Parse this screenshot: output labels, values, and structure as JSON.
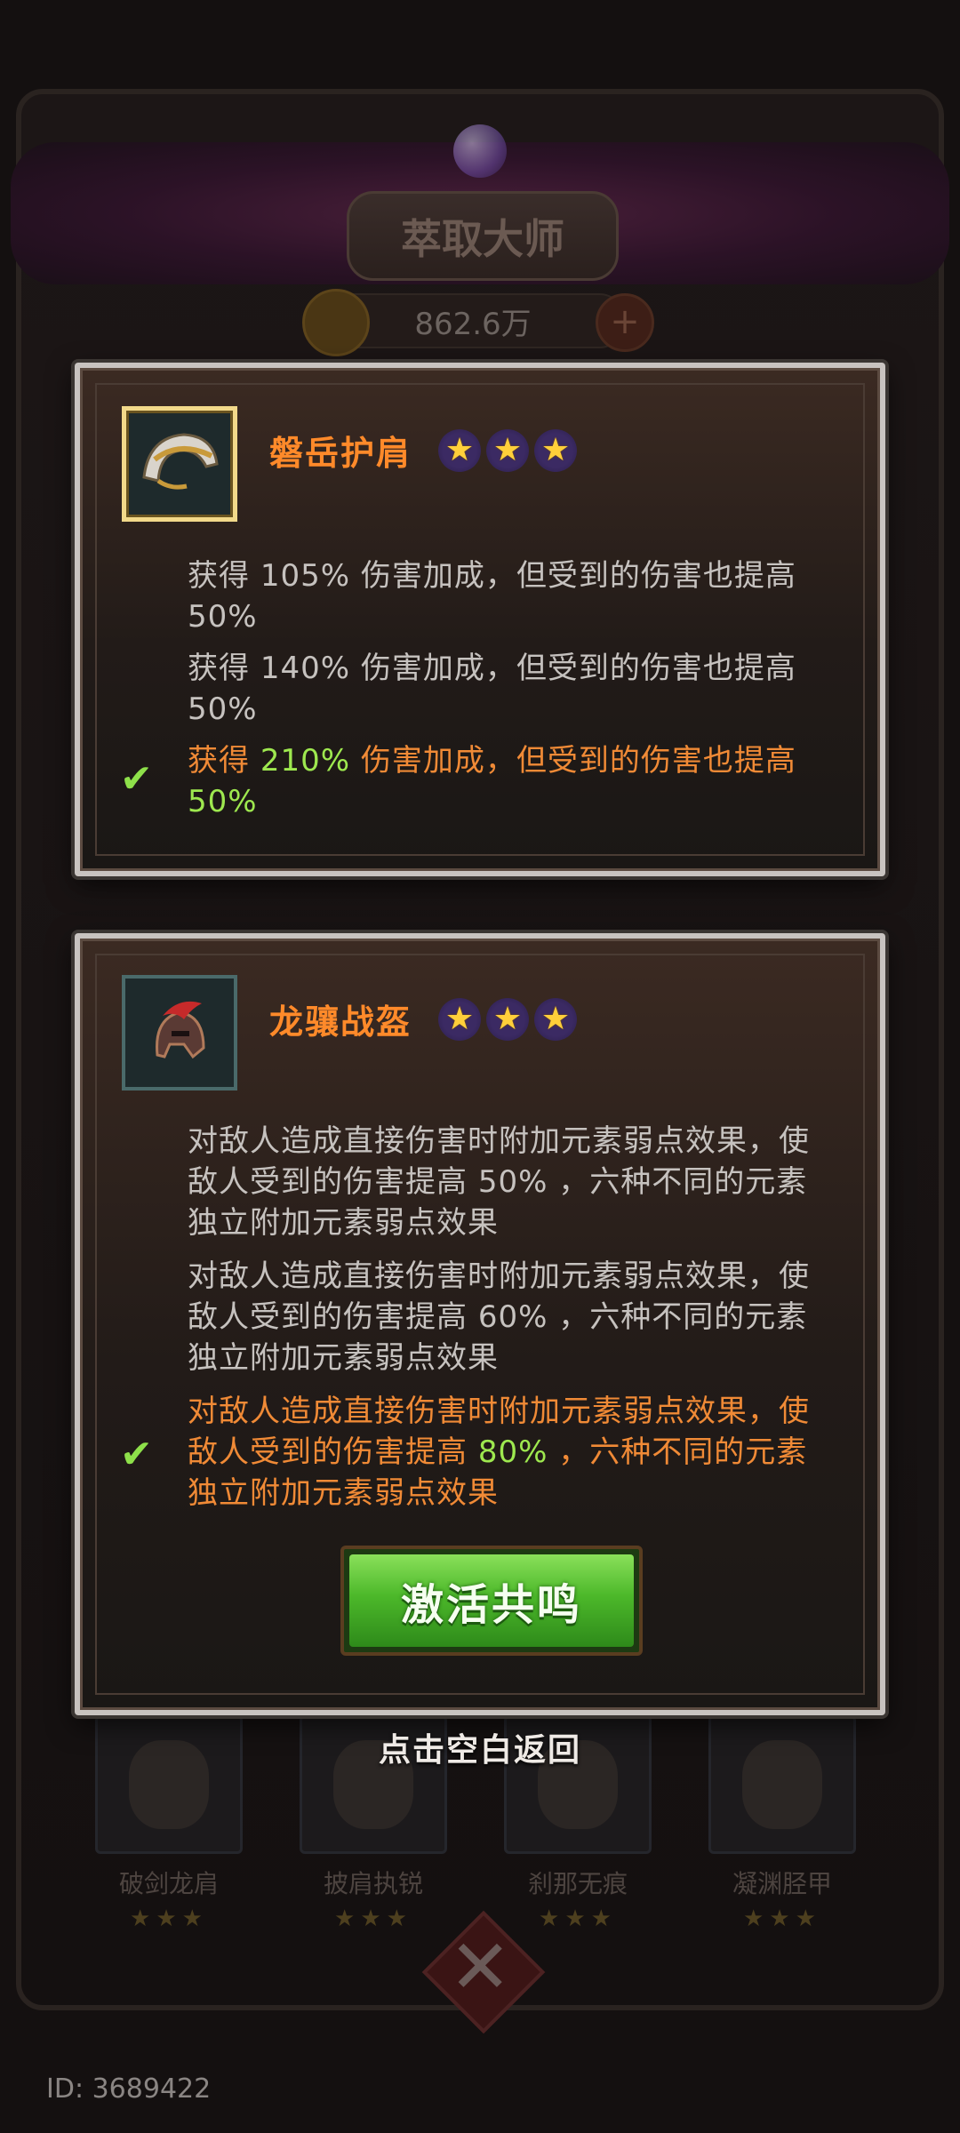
{
  "background": {
    "title": "萃取大师",
    "currency": "862.6万",
    "slots": [
      {
        "name": "破剑龙肩",
        "stars": "★★★"
      },
      {
        "name": "披肩执锐",
        "stars": "★★★"
      },
      {
        "name": "刹那无痕",
        "stars": "★★★"
      },
      {
        "name": "凝渊胫甲",
        "stars": "★★★"
      }
    ],
    "player_id": "ID: 3689422"
  },
  "cards": [
    {
      "name": "磐岳护肩",
      "stars": 3,
      "icon": "shoulder-armor-icon",
      "tiers": [
        {
          "prefix": "获得 ",
          "value": "105%",
          "suffix": " 伤害加成，但受到的伤害也提高",
          "value2": "50%",
          "active": false
        },
        {
          "prefix": "获得 ",
          "value": "140%",
          "suffix": " 伤害加成，但受到的伤害也提高",
          "value2": "50%",
          "active": false
        },
        {
          "prefix": "获得 ",
          "value": "210%",
          "suffix": " 伤害加成，但受到的伤害也提高",
          "value2": "50%",
          "active": true
        }
      ]
    },
    {
      "name": "龙骧战盔",
      "stars": 3,
      "icon": "helmet-icon",
      "tiers": [
        {
          "prefix": "对敌人造成直接伤害时附加元素弱点效果，使敌人受到的伤害提高 ",
          "value": "50%",
          "suffix": " ，六种不同的元素独立附加元素弱点效果",
          "active": false
        },
        {
          "prefix": "对敌人造成直接伤害时附加元素弱点效果，使敌人受到的伤害提高 ",
          "value": "60%",
          "suffix": " ，六种不同的元素独立附加元素弱点效果",
          "active": false
        },
        {
          "prefix": "对敌人造成直接伤害时附加元素弱点效果，使敌人受到的伤害提高 ",
          "value": "80%",
          "suffix": " ，六种不同的元素独立附加元素弱点效果",
          "active": true
        }
      ]
    }
  ],
  "activate_button": "激活共鸣",
  "dismiss_hint": "点击空白返回",
  "star_glyph": "★",
  "check_glyph": "✔",
  "colors": {
    "active_text": "#f08a36",
    "active_value": "#9ee84f",
    "item_name": "#ff8a2a",
    "button_green": "#4cb82a"
  }
}
